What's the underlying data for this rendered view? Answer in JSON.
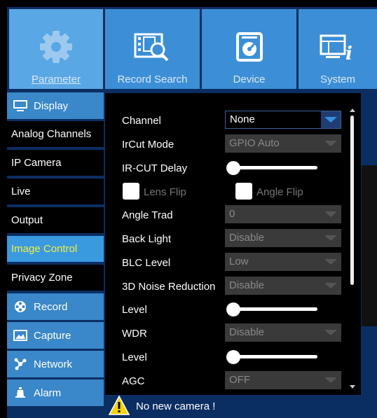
{
  "tabs": [
    {
      "label": "Parameter",
      "icon": "gear-icon",
      "active": true
    },
    {
      "label": "Record Search",
      "icon": "film-search-icon",
      "active": false
    },
    {
      "label": "Device",
      "icon": "hard-disk-icon",
      "active": false
    },
    {
      "label": "System",
      "icon": "system-info-icon",
      "active": false
    }
  ],
  "sidebar": {
    "display": {
      "label": "Display",
      "icon": "monitor-icon"
    },
    "subitems": [
      "Analog Channels",
      "IP Camera",
      "Live",
      "Output",
      "Image Control",
      "Privacy Zone"
    ],
    "active_subitem": "Image Control",
    "record": {
      "label": "Record",
      "icon": "film-reel-icon"
    },
    "capture": {
      "label": "Capture",
      "icon": "picture-icon"
    },
    "network": {
      "label": "Network",
      "icon": "network-icon"
    },
    "alarm": {
      "label": "Alarm",
      "icon": "bell-icon"
    }
  },
  "form": {
    "channel": {
      "label": "Channel",
      "value": "None"
    },
    "ircut_mode": {
      "label": "IrCut Mode",
      "value": "GPIO Auto"
    },
    "ircut_delay": {
      "label": "IR-CUT Delay",
      "level": 0
    },
    "lens_flip": {
      "label": "Lens Flip",
      "checked": false
    },
    "angle_flip": {
      "label": "Angle Flip",
      "checked": false
    },
    "angle_trad": {
      "label": "Angle Trad",
      "value": "0"
    },
    "back_light": {
      "label": "Back Light",
      "value": "Disable"
    },
    "blc_level": {
      "label": "BLC Level",
      "value": "Low"
    },
    "noise_reduction": {
      "label": "3D Noise Reduction",
      "value": "Disable"
    },
    "noise_level": {
      "label": "Level",
      "level": 0
    },
    "wdr": {
      "label": "WDR",
      "value": "Disable"
    },
    "wdr_level": {
      "label": "Level",
      "level": 0
    },
    "agc": {
      "label": "AGC",
      "value": "OFF"
    }
  },
  "status": {
    "message": "No new camera !",
    "icon": "warning-icon"
  },
  "colors": {
    "accent": "#3a9ae0",
    "active_text": "#f4ef3b",
    "frame": "#0b2e62",
    "tab": "#3c8fd6"
  }
}
